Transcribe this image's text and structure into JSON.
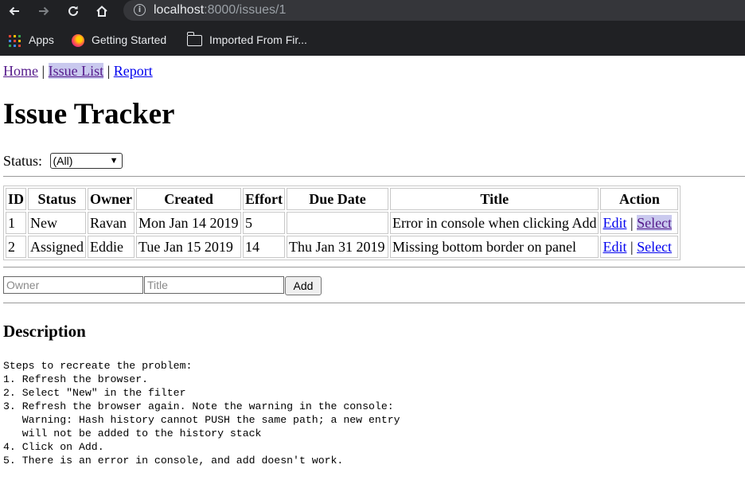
{
  "browser": {
    "url_host": "localhost",
    "url_path": ":8000/issues/1",
    "bookmarks": [
      {
        "label": "Apps"
      },
      {
        "label": "Getting Started"
      },
      {
        "label": "Imported From Fir..."
      }
    ]
  },
  "nav": {
    "home": "Home",
    "separator": "|",
    "issue_list": "Issue List",
    "report": "Report"
  },
  "page_title": "Issue Tracker",
  "filter": {
    "label": "Status:",
    "selected": "(All)"
  },
  "table": {
    "headers": [
      "ID",
      "Status",
      "Owner",
      "Created",
      "Effort",
      "Due Date",
      "Title",
      "Action"
    ],
    "rows": [
      {
        "id": "1",
        "status": "New",
        "owner": "Ravan",
        "created": "Mon Jan 14 2019",
        "effort": "5",
        "due": "",
        "title": "Error in console when clicking Add",
        "edit": "Edit",
        "sep": "|",
        "select": "Select"
      },
      {
        "id": "2",
        "status": "Assigned",
        "owner": "Eddie",
        "created": "Tue Jan 15 2019",
        "effort": "14",
        "due": "Thu Jan 31 2019",
        "title": "Missing bottom border on panel",
        "edit": "Edit",
        "sep": "|",
        "select": "Select"
      }
    ]
  },
  "add_form": {
    "owner_placeholder": "Owner",
    "title_placeholder": "Title",
    "add_label": "Add"
  },
  "description": {
    "heading": "Description",
    "body": "Steps to recreate the problem:\n1. Refresh the browser.\n2. Select \"New\" in the filter\n3. Refresh the browser again. Note the warning in the console:\n   Warning: Hash history cannot PUSH the same path; a new entry\n   will not be added to the history stack\n4. Click on Add.\n5. There is an error in console, and add doesn't work."
  },
  "colors": {
    "chrome_bg": "#202124",
    "omnibox_bg": "#35363a",
    "link": "#0000ee",
    "visited_link": "#551a8b",
    "selected_highlight": "#c9c9ee"
  }
}
